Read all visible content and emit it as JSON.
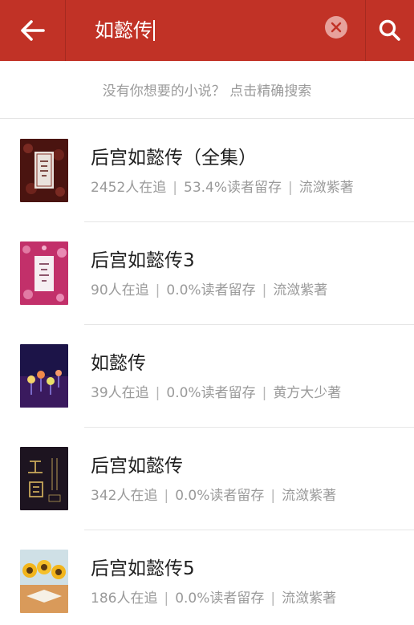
{
  "header": {
    "back_icon": "arrow-left-icon",
    "query": "如懿传",
    "clear_icon": "close-circle-icon",
    "search_icon": "search-icon",
    "accent_color": "#c13226"
  },
  "hint": {
    "text": "没有你想要的小说？ 点击精确搜索"
  },
  "results": [
    {
      "title": "后宫如懿传（全集）",
      "followers": "2452人在追",
      "retention": "53.4%读者留存",
      "author": "流潋紫著"
    },
    {
      "title": "后宫如懿传3",
      "followers": "90人在追",
      "retention": "0.0%读者留存",
      "author": "流潋紫著"
    },
    {
      "title": "如懿传",
      "followers": "39人在追",
      "retention": "0.0%读者留存",
      "author": "黄方大少著"
    },
    {
      "title": "后宫如懿传",
      "followers": "342人在追",
      "retention": "0.0%读者留存",
      "author": "流潋紫著"
    },
    {
      "title": "后宫如懿传5",
      "followers": "186人在追",
      "retention": "0.0%读者留存",
      "author": "流潋紫著"
    }
  ]
}
